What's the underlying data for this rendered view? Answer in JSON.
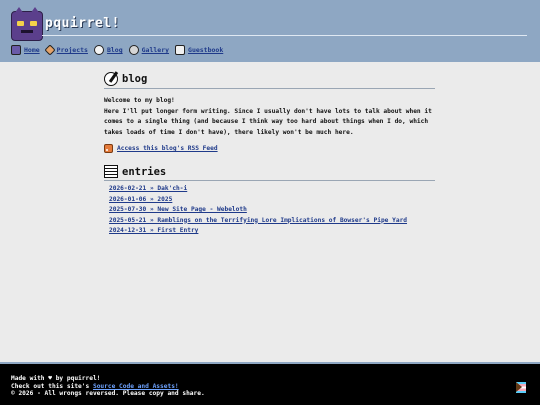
{
  "header": {
    "site_title": "pquirrel!",
    "nav": [
      {
        "label": "Home",
        "icon": "home-icon"
      },
      {
        "label": "Projects",
        "icon": "pencil-icon"
      },
      {
        "label": "Blog",
        "icon": "magnifier-icon"
      },
      {
        "label": "Gallery",
        "icon": "gallery-icon"
      },
      {
        "label": "Guestbook",
        "icon": "book-icon"
      }
    ]
  },
  "blog": {
    "title": "blog",
    "welcome": "Welcome to my blog!",
    "description": "Here I'll put longer form writing. Since I usually don't have lots to talk about when it comes to a single thing (and because I think way too hard about things when I do, which takes loads of time I don't have), there likely won't be much here.",
    "rss_label": "Access this blog's RSS Feed"
  },
  "entries": {
    "title": "entries",
    "items": [
      "2026-02-21 » Dak'ch-i",
      "2026-01-06 » 2025",
      "2025-07-30 » New Site Page - Webeloth",
      "2025-05-21 » Ramblings on the Terrifying Lore Implications of Bowser's Pipe Yard",
      "2024-12-31 » First Entry"
    ]
  },
  "footer": {
    "line1": "Made with ♥ by pquirrel!",
    "line2_prefix": "Check out this site's ",
    "line2_link": "Source Code and Assets!",
    "line3": "© 2026 - All wrongs reversed. Please copy and share."
  },
  "colors": {
    "header_bg": "#8ea7c3",
    "page_bg": "#ebebeb",
    "link": "#1f3a8a",
    "footer_bg": "#000000"
  }
}
